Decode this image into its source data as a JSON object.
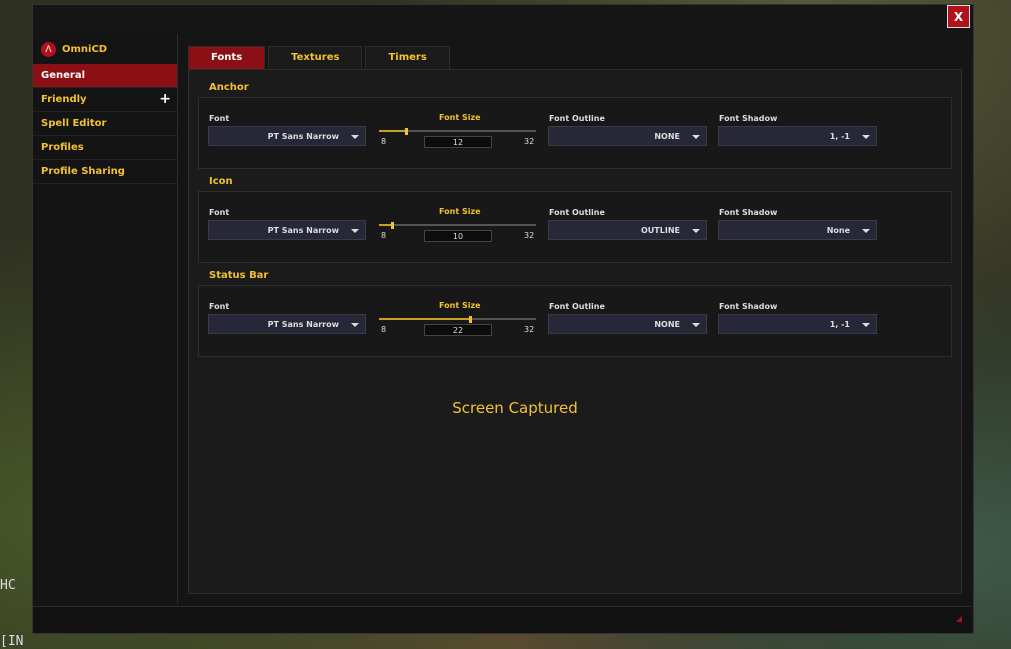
{
  "background": {
    "text_hc": "HC",
    "text_in": "[IN"
  },
  "window": {
    "close_label": "X"
  },
  "sidebar": {
    "app_name": "OmniCD",
    "items": [
      {
        "label": "General",
        "active": true
      },
      {
        "label": "Friendly",
        "expand": "+"
      },
      {
        "label": "Spell Editor"
      },
      {
        "label": "Profiles"
      },
      {
        "label": "Profile Sharing"
      }
    ]
  },
  "tabs": [
    {
      "label": "Fonts",
      "active": true
    },
    {
      "label": "Textures"
    },
    {
      "label": "Timers"
    }
  ],
  "sections": [
    {
      "title": "Anchor",
      "font_label": "Font",
      "font_value": "PT Sans Narrow",
      "size_label": "Font Size",
      "size_min": "8",
      "size_max": "32",
      "size_value": "12",
      "size_fraction": 0.17,
      "outline_label": "Font Outline",
      "outline_value": "NONE",
      "shadow_label": "Font Shadow",
      "shadow_value": "1, -1"
    },
    {
      "title": "Icon",
      "font_label": "Font",
      "font_value": "PT Sans Narrow",
      "size_label": "Font Size",
      "size_min": "8",
      "size_max": "32",
      "size_value": "10",
      "size_fraction": 0.08,
      "outline_label": "Font Outline",
      "outline_value": "OUTLINE",
      "shadow_label": "Font Shadow",
      "shadow_value": "None"
    },
    {
      "title": "Status Bar",
      "font_label": "Font",
      "font_value": "PT Sans Narrow",
      "size_label": "Font Size",
      "size_min": "8",
      "size_max": "32",
      "size_value": "22",
      "size_fraction": 0.58,
      "outline_label": "Font Outline",
      "outline_value": "NONE",
      "shadow_label": "Font Shadow",
      "shadow_value": "1, -1"
    }
  ],
  "overlay": {
    "text": "Screen Captured"
  },
  "colors": {
    "accent": "#f2c230",
    "active": "#8b0f15",
    "close": "#b0111a"
  }
}
